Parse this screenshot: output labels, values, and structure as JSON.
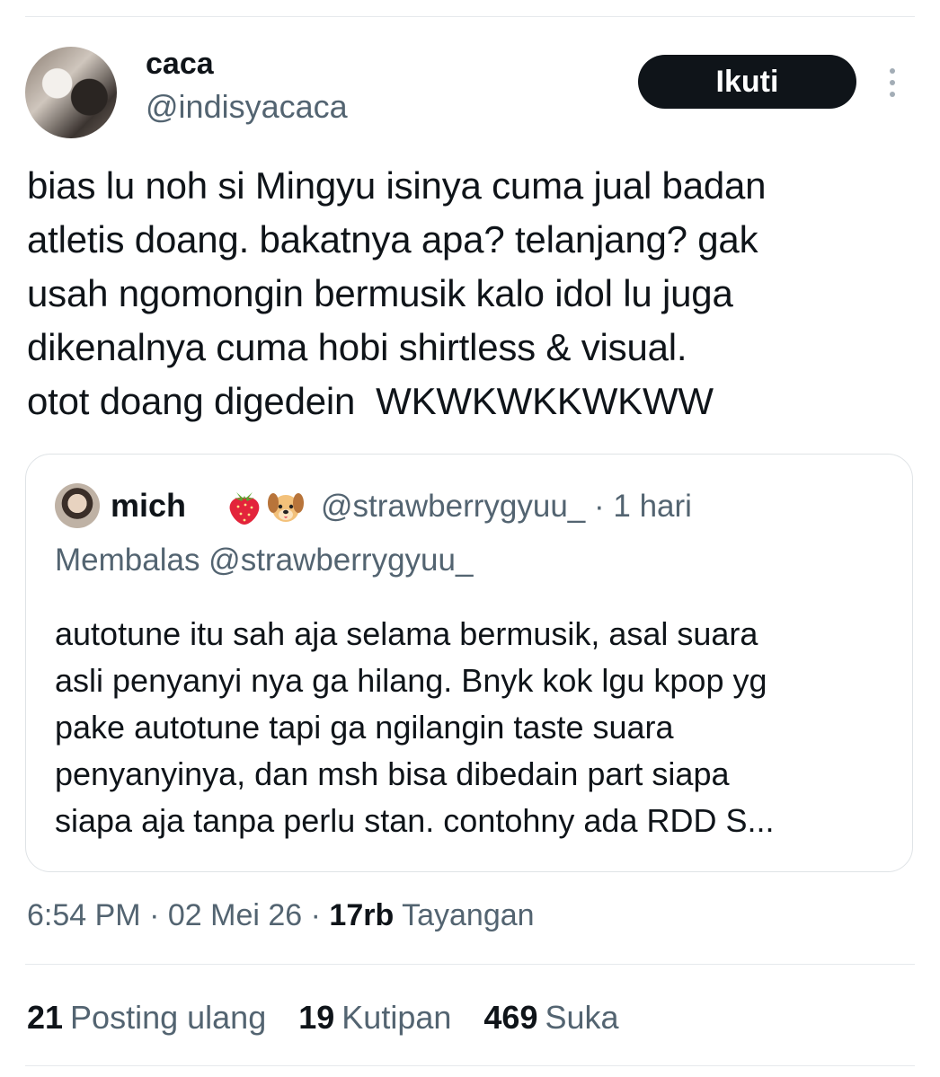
{
  "author": {
    "name": "caca",
    "handle": "@indisyacaca",
    "follow_label": "Ikuti"
  },
  "tweet": {
    "text": "bias lu noh si Mingyu isinya cuma jual badan\natletis doang. bakatnya apa? telanjang? gak\nusah ngomongin bermusik kalo idol lu juga\ndikenalnya cuma hobi shirtless & visual.\notot doang digedein  WKWKWKKWKWW"
  },
  "quote": {
    "name": "mich",
    "emojis": [
      "strawberry-emoji",
      "puppy-emoji"
    ],
    "handle": "@strawberrygyuu_",
    "time": "· 1 hari",
    "reply_to": "Membalas @strawberrygyuu_",
    "text": "autotune itu sah aja selama bermusik, asal suara\nasli penyanyi nya ga hilang. Bnyk kok lgu kpop yg\npake autotune tapi ga ngilangin taste suara\npenyanyinya, dan msh bisa dibedain part siapa\nsiapa aja tanpa perlu stan. contohny ada RDD S..."
  },
  "meta": {
    "time": "6:54 PM",
    "date": "02 Mei 26",
    "views_count": "17rb",
    "views_label": "Tayangan"
  },
  "stats": {
    "reposts_count": "21",
    "reposts_label": "Posting ulang",
    "quotes_count": "19",
    "quotes_label": "Kutipan",
    "likes_count": "469",
    "likes_label": "Suka"
  },
  "colors": {
    "text_primary": "#0f1419",
    "text_secondary": "#536471",
    "button_bg": "#0f1419",
    "border": "#dfe3e6"
  }
}
